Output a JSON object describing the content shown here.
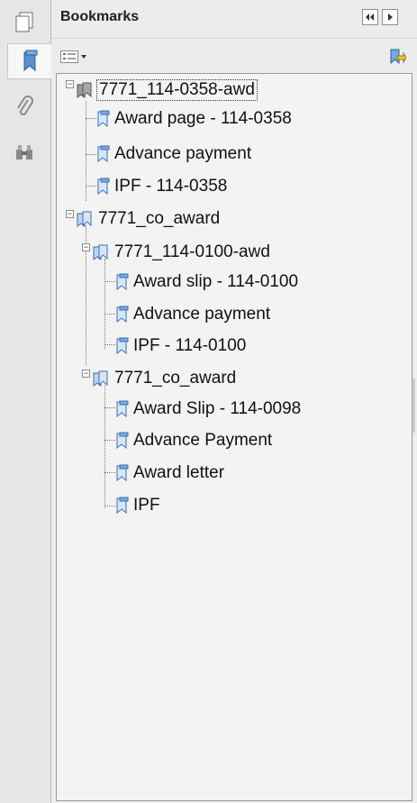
{
  "panel": {
    "title": "Bookmarks",
    "options_icon": "bookmark-options-icon",
    "tag_icon": "new-bookmark-from-structure-icon",
    "collapse_icon": "collapse-panel-icon",
    "expand_icon": "expand-panel-icon"
  },
  "rail": {
    "items": [
      "page-thumbnails-icon",
      "bookmarks-icon",
      "attachments-icon",
      "search-binoculars-icon"
    ]
  },
  "tree": {
    "n1": {
      "label": "7771_114-0358-awd",
      "expanded": true
    },
    "n1a": {
      "label": "Award page - 114-0358"
    },
    "n1b": {
      "label": "Advance payment"
    },
    "n1c": {
      "label": "IPF - 114-0358"
    },
    "n2": {
      "label": "7771_co_award",
      "expanded": true
    },
    "n2a": {
      "label": "7771_114-0100-awd",
      "expanded": true
    },
    "n2a1": {
      "label": "Award slip - 114-0100"
    },
    "n2a2": {
      "label": "Advance payment"
    },
    "n2a3": {
      "label": "IPF - 114-0100"
    },
    "n2b": {
      "label": "7771_co_award",
      "expanded": true
    },
    "n2b1": {
      "label": "Award Slip - 114-0098"
    },
    "n2b2": {
      "label": "Advance Payment"
    },
    "n2b3": {
      "label": "Award letter"
    },
    "n2b4": {
      "label": "IPF"
    }
  },
  "colors": {
    "bookmark_icon": "#4a7fc1",
    "panel_bg": "#f3f3f3",
    "rail_bg": "#e6e6e6"
  }
}
